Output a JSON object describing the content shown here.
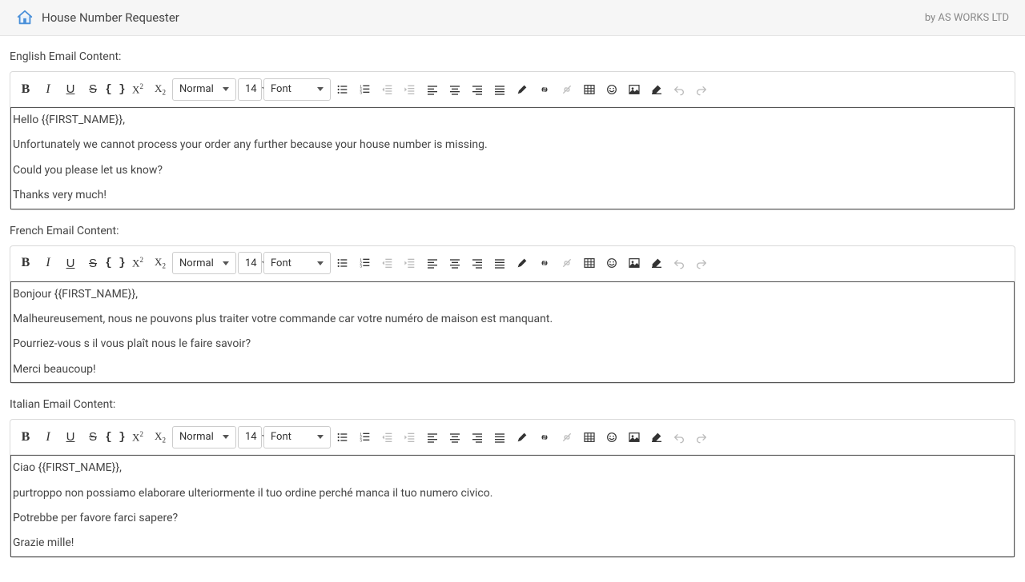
{
  "header": {
    "app_title": "House Number Requester",
    "by_line": "by AS WORKS LTD"
  },
  "toolbar": {
    "normal_label": "Normal",
    "size_label": "14",
    "font_label": "Font"
  },
  "sections": {
    "english": {
      "label": "English Email Content:",
      "paras": [
        "Hello {{FIRST_NAME}},",
        "Unfortunately we cannot process your order any further because your house number is missing.",
        "Could you please let us know?",
        "Thanks very much!"
      ]
    },
    "french": {
      "label": "French Email Content:",
      "paras": [
        "Bonjour {{FIRST_NAME}},",
        "Malheureusement, nous ne pouvons plus traiter votre commande car votre numéro de maison est manquant.",
        "Pourriez-vous s il vous plaît nous le faire savoir?",
        "Merci beaucoup!"
      ]
    },
    "italian": {
      "label": "Italian Email Content:",
      "paras": [
        "Ciao {{FIRST_NAME}},",
        "purtroppo non possiamo elaborare ulteriormente il tuo ordine perché manca il tuo numero civico.",
        "Potrebbe per favore farci sapere?",
        "Grazie mille!"
      ]
    }
  }
}
